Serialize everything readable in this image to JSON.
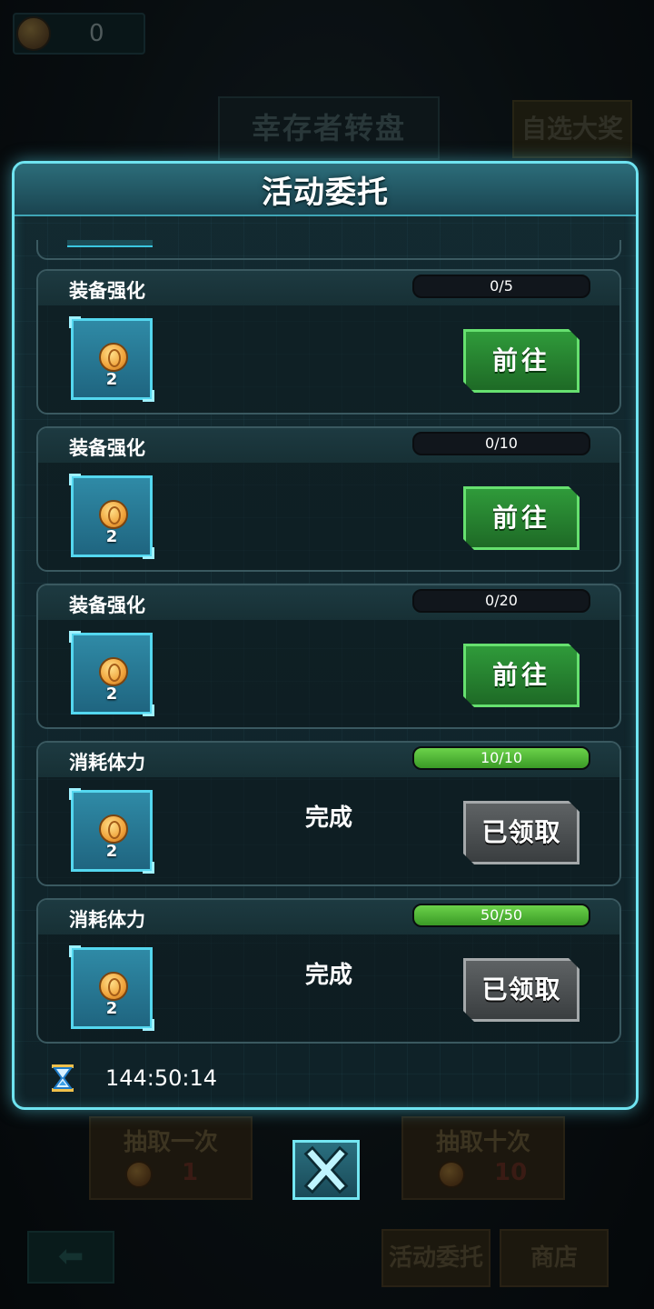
{
  "background": {
    "coin_count": "0",
    "title": "幸存者转盘",
    "top_right_button": "自选大奖",
    "draw_once": {
      "label": "抽取一次",
      "cost": "1"
    },
    "draw_ten": {
      "label": "抽取十次",
      "cost": "10"
    },
    "nav_tasks": "活动委托",
    "nav_shop": "商店"
  },
  "dialog": {
    "title": "活动委托",
    "tasks": [
      {
        "name": "装备强化",
        "progress_text": "0/5",
        "progress": 0.0,
        "reward_qty": "2",
        "status": "",
        "button": "前往",
        "button_state": "go"
      },
      {
        "name": "装备强化",
        "progress_text": "0/10",
        "progress": 0.0,
        "reward_qty": "2",
        "status": "",
        "button": "前往",
        "button_state": "go"
      },
      {
        "name": "装备强化",
        "progress_text": "0/20",
        "progress": 0.0,
        "reward_qty": "2",
        "status": "",
        "button": "前往",
        "button_state": "go"
      },
      {
        "name": "消耗体力",
        "progress_text": "10/10",
        "progress": 1.0,
        "reward_qty": "2",
        "status": "完成",
        "button": "已领取",
        "button_state": "done"
      },
      {
        "name": "消耗体力",
        "progress_text": "50/50",
        "progress": 1.0,
        "reward_qty": "2",
        "status": "完成",
        "button": "已领取",
        "button_state": "done"
      }
    ],
    "timer": "144:50:14"
  },
  "colors": {
    "accent": "#6fe3f0",
    "go": "#2f9a3a",
    "done": "#5e6264",
    "progress": "#6bd24a"
  },
  "icons": {
    "coin": "coin-icon",
    "timer": "hourglass-icon",
    "close": "close-icon",
    "back": "back-arrow-icon"
  }
}
